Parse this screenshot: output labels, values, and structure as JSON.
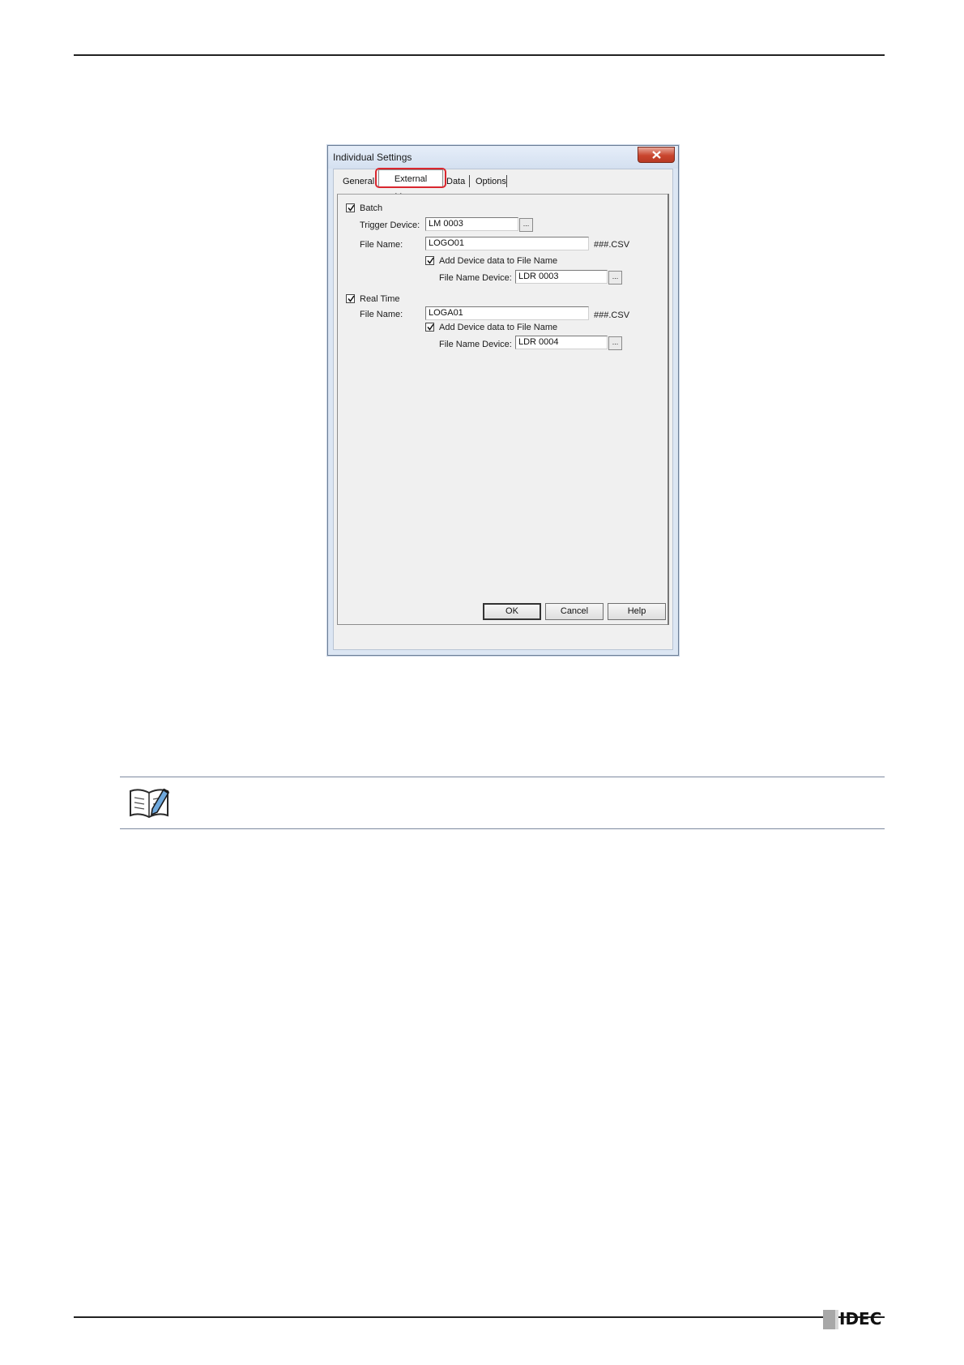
{
  "dialog": {
    "title": "Individual Settings",
    "close_label": "X",
    "tabs": [
      "General",
      "External Memory",
      "Data",
      "Options"
    ],
    "active_tab": "External Memory",
    "batch": {
      "checkbox_label": "Batch",
      "checked": true,
      "trigger_device_label": "Trigger Device:",
      "trigger_device_value": "LM 0003",
      "file_name_label": "File Name:",
      "file_name_value": "LOGO01",
      "file_ext": "###.CSV",
      "add_device_label": "Add Device data to File Name",
      "add_device_checked": true,
      "file_name_device_label": "File Name Device:",
      "file_name_device_value": "LDR 0003"
    },
    "realtime": {
      "checkbox_label": "Real Time",
      "checked": true,
      "file_name_label": "File Name:",
      "file_name_value": "LOGA01",
      "file_ext": "###.CSV",
      "add_device_label": "Add Device data to File Name",
      "add_device_checked": true,
      "file_name_device_label": "File Name Device:",
      "file_name_device_value": "LDR 0004"
    },
    "browse_label": "...",
    "buttons": {
      "ok": "OK",
      "cancel": "Cancel",
      "help": "Help"
    }
  },
  "footer": {
    "logo_text": "IDEC"
  },
  "colors": {
    "highlight": "#d9262e",
    "rule": "#222222",
    "note_rule": "#7d8aa0"
  }
}
